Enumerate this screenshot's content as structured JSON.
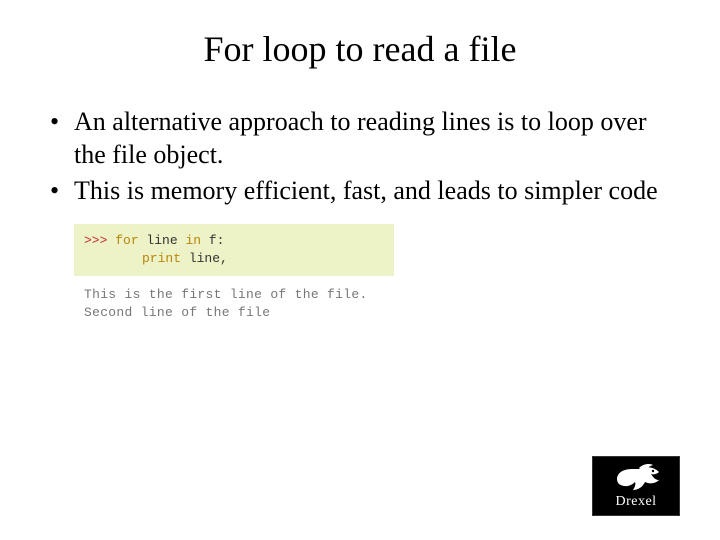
{
  "title": "For loop to read a file",
  "bullets": [
    "An alternative approach to reading lines is to loop over the file object.",
    "This is memory efficient, fast, and leads to simpler code"
  ],
  "code": {
    "prompt": ">>>",
    "line1_pre": "for",
    "line1_mid": " line ",
    "line1_in": "in",
    "line1_post": " f:",
    "line2_kw": "print",
    "line2_rest": " line,",
    "output1": "This is the first line of the file.",
    "output2": "Second line of the file"
  },
  "logo": {
    "text": "Drexel"
  }
}
